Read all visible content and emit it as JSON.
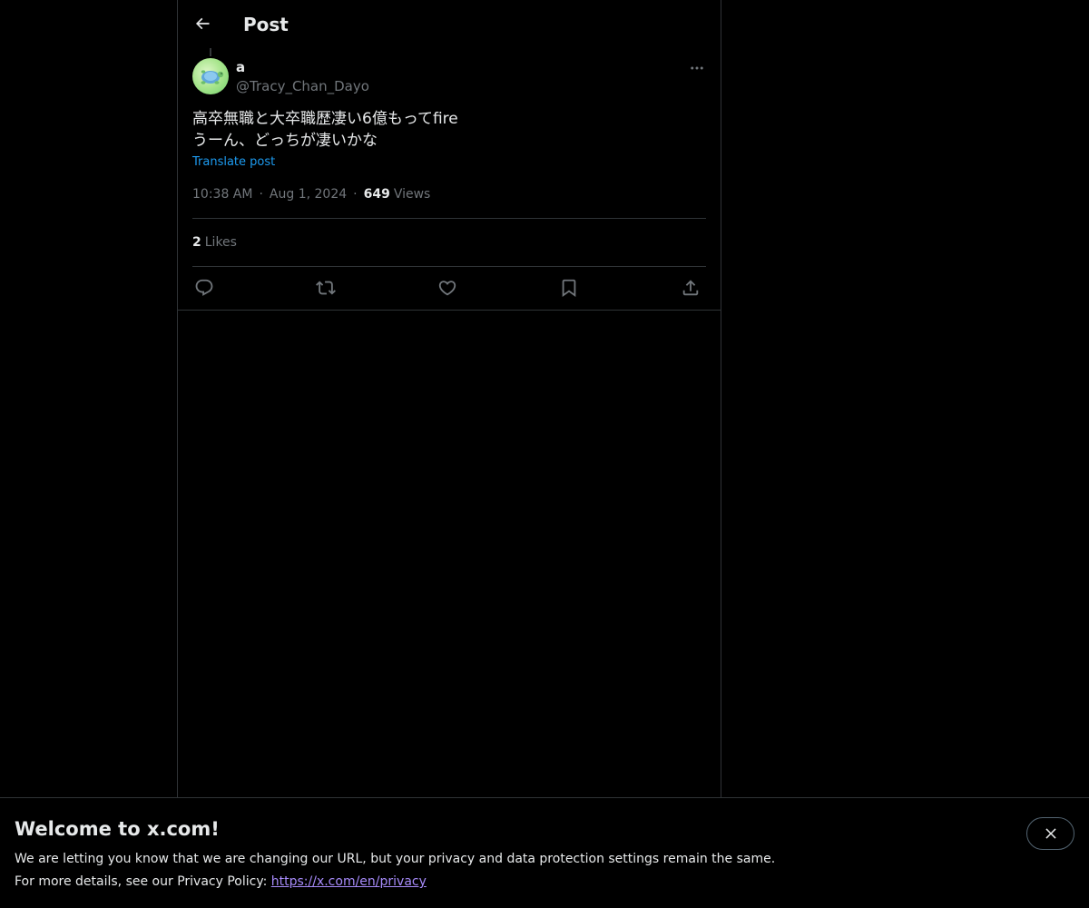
{
  "header": {
    "title": "Post",
    "back_icon": "arrow-left-icon"
  },
  "post": {
    "author_name": "a",
    "author_handle": "@Tracy_Chan_Dayo",
    "text": "高卒無職と大卒職歴凄い6億もってfire\nうーん、どっちが凄いかな",
    "translate_label": "Translate post",
    "time": "10:38 AM",
    "separator": "·",
    "date": "Aug 1, 2024",
    "views_count": "649",
    "views_label": "Views",
    "likes_count": "2",
    "likes_label": "Likes"
  },
  "actions": {
    "reply": "reply-icon",
    "repost": "repost-icon",
    "like": "heart-icon",
    "bookmark": "bookmark-icon",
    "share": "share-icon"
  },
  "banner": {
    "title": "Welcome to x.com!",
    "line1": "We are letting you know that we are changing our URL, but your privacy and data protection settings remain the same.",
    "line2_prefix": "For more details, see our Privacy Policy: ",
    "link_text": "https://x.com/en/privacy"
  },
  "colors": {
    "background": "#000000",
    "text": "#e7e9ea",
    "muted": "#71767b",
    "accent": "#1d9bf0",
    "border": "#2f3336",
    "link_visited": "#a78bfa"
  }
}
